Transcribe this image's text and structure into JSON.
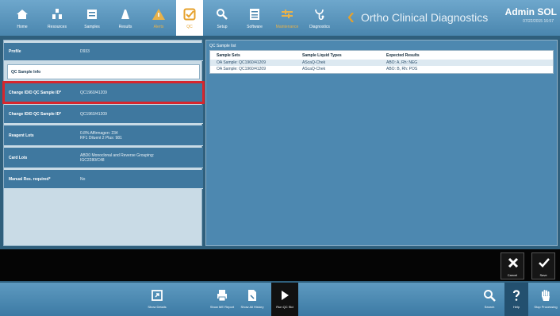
{
  "topbar": {
    "buttons": [
      {
        "id": "home",
        "label": "Home",
        "icon": "home-icon"
      },
      {
        "id": "resources",
        "label": "Resources",
        "icon": "resources-icon"
      },
      {
        "id": "samples",
        "label": "Samples",
        "icon": "samples-icon"
      },
      {
        "id": "results",
        "label": "Results",
        "icon": "results-icon"
      },
      {
        "id": "alerts",
        "label": "Alerts",
        "icon": "alert-icon"
      },
      {
        "id": "qc",
        "label": "QC",
        "icon": "qc-checkbox-icon"
      },
      {
        "id": "setup",
        "label": "Setup",
        "icon": "setup-icon"
      },
      {
        "id": "software",
        "label": "Software",
        "icon": "software-icon"
      },
      {
        "id": "maintenance",
        "label": "Maintenance",
        "icon": "maintenance-icon"
      },
      {
        "id": "diagnostics",
        "label": "Diagnostics",
        "icon": "diagnostics-icon"
      }
    ],
    "brand": "Ortho Clinical Diagnostics",
    "admin": "Admin SOL",
    "admin_sub": "07/22/2015 16:57"
  },
  "left_panel": {
    "profile_label": "Profile",
    "profile_value": "D933",
    "qc_sample_info": "QC Sample Info",
    "rows": [
      {
        "label": "Change ID/D QC Sample ID*",
        "value": "QC1960/41209"
      },
      {
        "label": "Change ID/D QC Sample ID*",
        "value": "QC1960/41209"
      },
      {
        "label": "Reagent Lots",
        "value": "0.8% Affirmagen: 234\nRF1 Diluent 2 Plus: 981"
      },
      {
        "label": "Card Lots",
        "value": "ABD0 Monoclonal and Reverse Grouping:\nIGC2280/C48"
      },
      {
        "label": "Manual Res. required*",
        "value": "No"
      }
    ]
  },
  "right_panel": {
    "title": "QC Sample list",
    "columns": [
      "Sample Sets",
      "Sample Liquid Types",
      "Expected Results"
    ],
    "rows": [
      [
        "OA Sample: QC1960/41209",
        "AScaQ-Chek",
        "ABO: A, Rh: NEG"
      ],
      [
        "OA Sample: QC1960/41209",
        "AScaQ-Chek",
        "ABO: B, Rh: POS"
      ]
    ]
  },
  "actions": {
    "cancel": "Cancel",
    "save": "Save"
  },
  "bottombar": {
    "show_details": "Show Details",
    "show_me_report": "Show ME Report",
    "show_history": "Show All History",
    "run_qc": "Run QC Std",
    "search": "Search",
    "help": "Help",
    "stop_processing": "Stop Processing"
  },
  "colors": {
    "accent": "#e6a12b",
    "highlight": "#d7262d",
    "panel": "#3f789f"
  }
}
